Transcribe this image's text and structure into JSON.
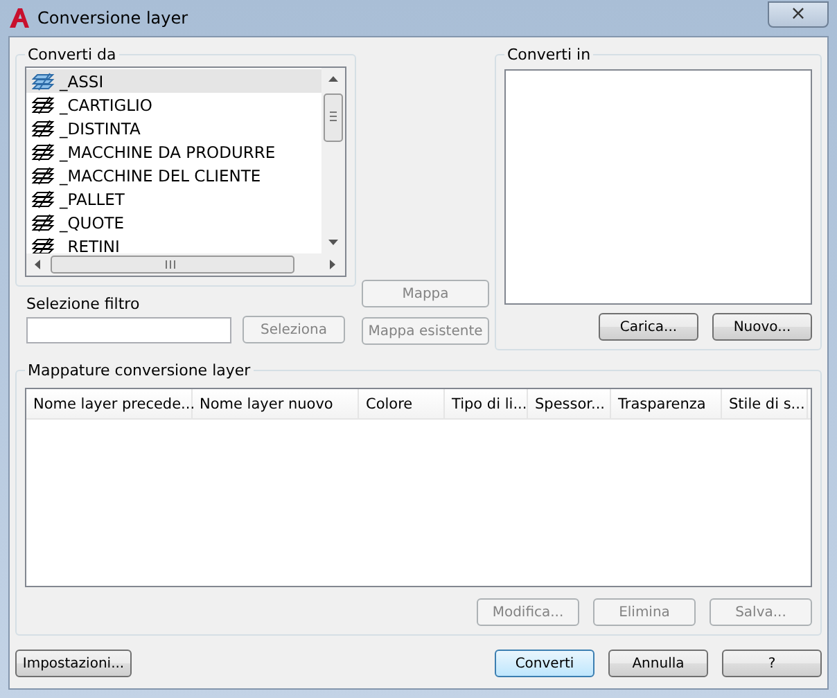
{
  "window": {
    "title": "Conversione layer",
    "close": "×"
  },
  "convert_from": {
    "label": "Converti da",
    "layers": [
      {
        "name": "_ASSI",
        "selected": true
      },
      {
        "name": "_CARTIGLIO",
        "selected": false
      },
      {
        "name": "_DISTINTA",
        "selected": false
      },
      {
        "name": "_MACCHINE DA PRODURRE",
        "selected": false
      },
      {
        "name": "_MACCHINE DEL CLIENTE",
        "selected": false
      },
      {
        "name": "_PALLET",
        "selected": false
      },
      {
        "name": "_QUOTE",
        "selected": false
      },
      {
        "name": "_RETINI",
        "selected": false
      }
    ]
  },
  "filter": {
    "label": "Selezione filtro",
    "button": {
      "label": "Seleziona",
      "disabled": true
    }
  },
  "map_buttons": [
    {
      "label": "Mappa",
      "disabled": true
    },
    {
      "label": "Mappa esistente",
      "disabled": true
    }
  ],
  "convert_to": {
    "label": "Converti in",
    "buttons": [
      {
        "label": "Carica...",
        "disabled": false
      },
      {
        "label": "Nuovo...",
        "disabled": false
      }
    ]
  },
  "mappings": {
    "label": "Mappature conversione layer",
    "columns": [
      "Nome layer precede...",
      "Nome layer nuovo",
      "Colore",
      "Tipo di li...",
      "Spessor...",
      "Trasparenza",
      "Stile di s..."
    ],
    "buttons": [
      {
        "label": "Modifica...",
        "disabled": true
      },
      {
        "label": "Elimina",
        "disabled": true
      },
      {
        "label": "Salva...",
        "disabled": true
      }
    ]
  },
  "footer": {
    "settings": {
      "label": "Impostazioni..."
    },
    "buttons": [
      {
        "label": "Converti",
        "default": true
      },
      {
        "label": "Annulla",
        "default": false
      },
      {
        "label": "?",
        "default": false
      }
    ]
  }
}
